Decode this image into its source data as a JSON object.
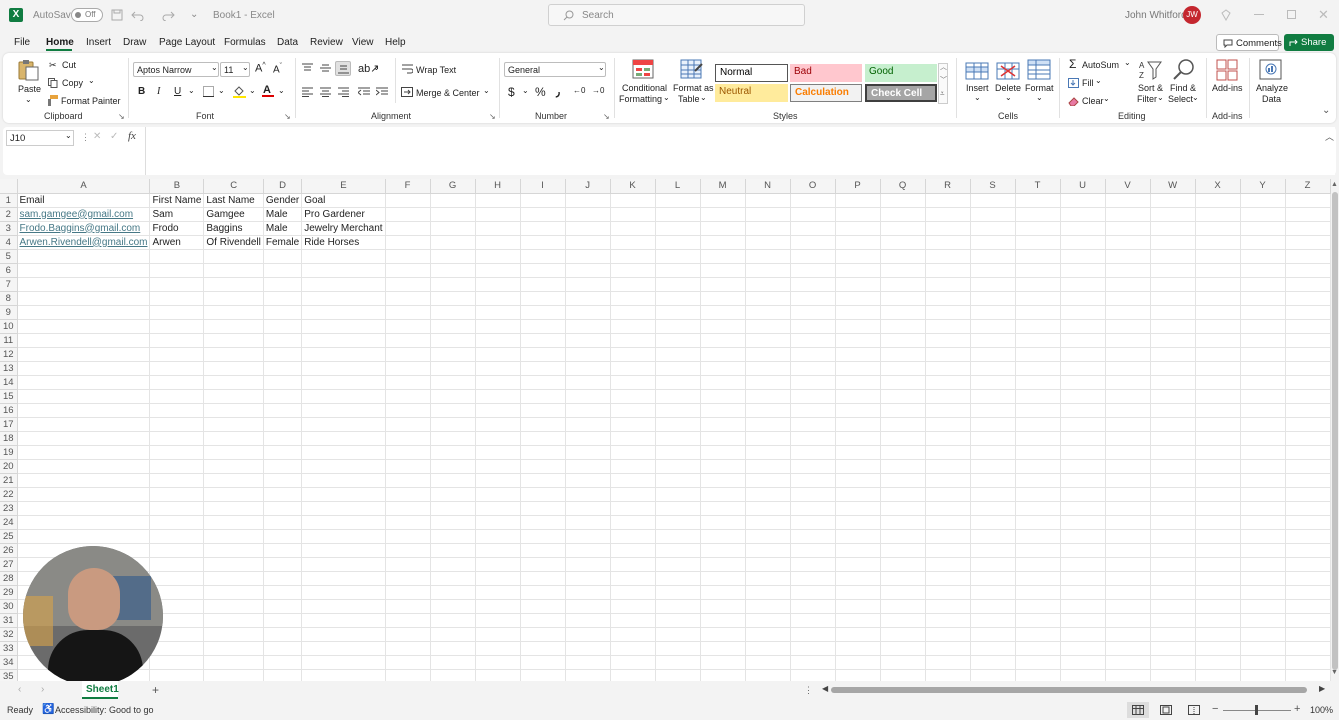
{
  "window": {
    "autosave_label": "AutoSave",
    "autosave_state": "Off",
    "title": "Book1  -  Excel",
    "search_placeholder": "Search",
    "user_name": "John Whitford",
    "user_initials": "JW"
  },
  "menu": [
    "File",
    "Home",
    "Insert",
    "Draw",
    "Page Layout",
    "Formulas",
    "Data",
    "Review",
    "View",
    "Help"
  ],
  "comments_label": "Comments",
  "share_label": "Share",
  "ribbon": {
    "clipboard": {
      "paste": "Paste",
      "cut": "Cut",
      "copy": "Copy",
      "format_painter": "Format Painter",
      "group": "Clipboard"
    },
    "font": {
      "name": "Aptos Narrow",
      "size": "11",
      "bold": "B",
      "italic": "I",
      "underline": "U",
      "group": "Font"
    },
    "alignment": {
      "wrap": "Wrap Text",
      "merge": "Merge & Center",
      "group": "Alignment"
    },
    "number": {
      "format": "General",
      "group": "Number"
    },
    "styles": {
      "cond1": "Conditional",
      "cond2": "Formatting",
      "fat1": "Format as",
      "fat2": "Table",
      "normal": "Normal",
      "bad": "Bad",
      "good": "Good",
      "neutral": "Neutral",
      "calculation": "Calculation",
      "check": "Check Cell",
      "group": "Styles"
    },
    "cells": {
      "insert": "Insert",
      "delete": "Delete",
      "format": "Format",
      "group": "Cells"
    },
    "editing": {
      "autosum": "AutoSum",
      "fill": "Fill",
      "clear": "Clear",
      "sort1": "Sort &",
      "sort2": "Filter",
      "find1": "Find &",
      "find2": "Select",
      "group": "Editing"
    },
    "addins": {
      "addins": "Add-ins",
      "analyze1": "Analyze",
      "analyze2": "Data",
      "group": "Add-ins"
    }
  },
  "formula_bar": {
    "name_box": "J10",
    "fx": "fx",
    "content": ""
  },
  "columns": [
    "A",
    "B",
    "C",
    "D",
    "E",
    "F",
    "G",
    "H",
    "I",
    "J",
    "K",
    "L",
    "M",
    "N",
    "O",
    "P",
    "Q",
    "R",
    "S",
    "T",
    "U",
    "V",
    "W",
    "X",
    "Y",
    "Z"
  ],
  "rows": [
    [
      "Email",
      "First Name",
      "Last Name",
      "Gender",
      "Goal"
    ],
    [
      "sam.gamgee@gmail.com",
      "Sam",
      "Gamgee",
      "Male",
      "Pro Gardener"
    ],
    [
      "Frodo.Baggins@gmail.com",
      "Frodo",
      "Baggins",
      "Male",
      "Jewelry Merchant"
    ],
    [
      "Arwen.Rivendell@gmail.com",
      "Arwen",
      "Of Rivendell",
      "Female",
      "Ride Horses"
    ]
  ],
  "row_count": 35,
  "sheet_tab": "Sheet1",
  "status": {
    "ready": "Ready",
    "accessibility": "Accessibility: Good to go",
    "zoom": "100%"
  }
}
